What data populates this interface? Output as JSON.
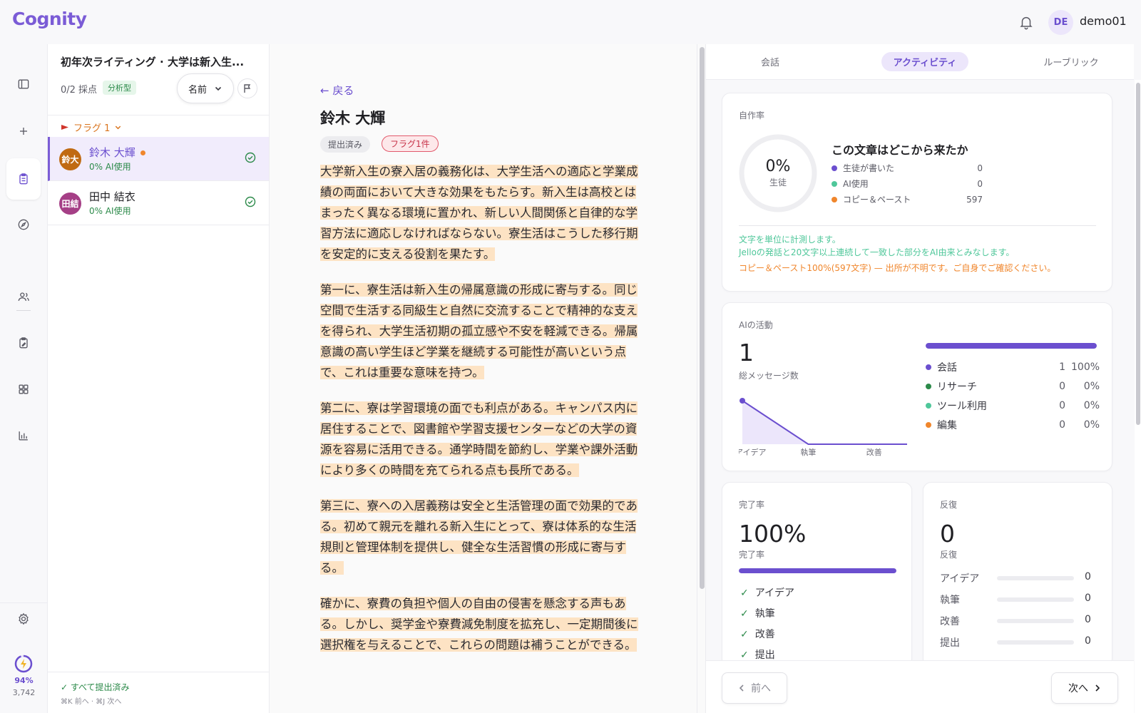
{
  "app": {
    "logo": "Cognity"
  },
  "header": {
    "avatar_initials": "DE",
    "user_name": "demo01"
  },
  "rail": {
    "items": [
      "sidebar-toggle-icon",
      "plus-icon",
      "clipboard-icon",
      "compass-icon",
      "users-icon",
      "clipboard-edit-icon",
      "grid-icon",
      "bar-chart-icon"
    ],
    "settings": "gear-icon",
    "power_pct": "94%",
    "power_count": "3,742"
  },
  "list": {
    "course_title": "初年次ライティング · 大学は新入生...",
    "graded": "0/2 採点",
    "type_badge": "分析型",
    "sort_label": "名前",
    "flag_group": "フラグ 1",
    "students": [
      {
        "initials": "鈴大",
        "name": "鈴木 大輝",
        "ai": "0% AI使用",
        "color": "#c06a12",
        "active": true,
        "unread": true
      },
      {
        "initials": "田結",
        "name": "田中 結衣",
        "ai": "0% AI使用",
        "color": "#a53f86",
        "active": false,
        "unread": false
      }
    ],
    "all_submitted": "✓ すべて提出済み",
    "shortcuts": "⌘K 前へ · ⌘J 次へ"
  },
  "essay": {
    "back": "← 戻る",
    "student_name": "鈴木 大輝",
    "status_badge": "提出済み",
    "flag_badge": "フラグ1件",
    "paragraphs": [
      "大学新入生の寮入居の義務化は、大学生活への適応と学業成績の両面において大きな効果をもたらす。新入生は高校とはまったく異なる環境に置かれ、新しい人間関係と自律的な学習方法に適応しなければならない。寮生活はこうした移行期を安定的に支える役割を果たす。",
      "第一に、寮生活は新入生の帰属意識の形成に寄与する。同じ空間で生活する同級生と自然に交流することで精神的な支えを得られ、大学生活初期の孤立感や不安を軽減できる。帰属意識の高い学生ほど学業を継続する可能性が高いという点で、これは重要な意味を持つ。",
      "第二に、寮は学習環境の面でも利点がある。キャンパス内に居住することで、図書館や学習支援センターなどの大学の資源を容易に活用できる。通学時間を節約し、学業や課外活動により多くの時間を充てられる点も長所である。",
      "第三に、寮への入居義務は安全と生活管理の面で効果的である。初めて親元を離れる新入生にとって、寮は体系的な生活規則と管理体制を提供し、健全な生活習慣の形成に寄与する。",
      "確かに、寮費の負担や個人の自由の侵害を懸念する声もある。しかし、奨学金や寮費減免制度を拡充し、一定期間後に選択権を与えることで、これらの問題は補うことができる。"
    ]
  },
  "right": {
    "tabs": [
      "会話",
      "アクティビティ",
      "ルーブリック"
    ],
    "active_tab": "アクティビティ",
    "authorship": {
      "label": "自作率",
      "percent": "0%",
      "percent_sub": "生徒",
      "title": "この文章はどこから来たか",
      "rows": [
        {
          "label": "生徒が書いた",
          "value": "0",
          "color": "#6b4fcf"
        },
        {
          "label": "AI使用",
          "value": "0",
          "color": "#4fc79a"
        },
        {
          "label": "コピー＆ペースト",
          "value": "597",
          "color": "#f0862c"
        }
      ],
      "note1": "文字を単位に計測します。",
      "note2": "Jelloの発話と20文字以上連続して一致した部分をAI由来とみなします。",
      "note3": "コピー＆ペースト100%(597文字) — 出所が不明です。ご自身でご確認ください。",
      "note_color": "#4fc79a",
      "warn_color": "#f0862c"
    },
    "ai_activity": {
      "label": "AIの活動",
      "total": "1",
      "total_sub": "総メッセージ数",
      "x_labels": [
        "アイデア",
        "執筆",
        "改善"
      ],
      "chart_data": {
        "type": "area",
        "x": [
          "アイデア",
          "執筆",
          "改善"
        ],
        "values": [
          1,
          0,
          0
        ]
      },
      "bar_fraction": 1.0,
      "rows": [
        {
          "label": "会話",
          "count": "1",
          "pct": "100%",
          "color": "#6b4fcf"
        },
        {
          "label": "リサーチ",
          "count": "0",
          "pct": "0%",
          "color": "#2c8a4a"
        },
        {
          "label": "ツール利用",
          "count": "0",
          "pct": "0%",
          "color": "#4fc79a"
        },
        {
          "label": "編集",
          "count": "0",
          "pct": "0%",
          "color": "#f0862c"
        }
      ]
    },
    "completion": {
      "label": "完了率",
      "value": "100%",
      "sub": "完了率",
      "fraction": 1.0,
      "steps": [
        "アイデア",
        "執筆",
        "改善",
        "提出"
      ]
    },
    "iteration": {
      "label": "反復",
      "value": "0",
      "sub": "反復",
      "rows": [
        {
          "label": "アイデア",
          "value": "0"
        },
        {
          "label": "執筆",
          "value": "0"
        },
        {
          "label": "改善",
          "value": "0"
        },
        {
          "label": "提出",
          "value": "0"
        }
      ]
    },
    "prev_label": "前へ",
    "next_label": "次へ"
  }
}
